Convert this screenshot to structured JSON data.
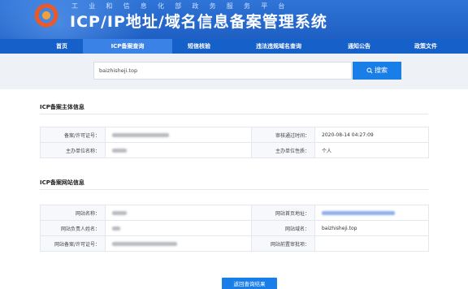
{
  "header": {
    "subtitle": "工业和信息化部政务服务平台",
    "title": "ICP/IP地址/域名信息备案管理系统"
  },
  "nav": {
    "items": [
      {
        "label": "首页",
        "active": false
      },
      {
        "label": "ICP备案查询",
        "active": true
      },
      {
        "label": "短信核验",
        "active": false
      },
      {
        "label": "违法违规域名查询",
        "active": false
      },
      {
        "label": "通知公告",
        "active": false
      },
      {
        "label": "政策文件",
        "active": false
      }
    ]
  },
  "search": {
    "value": "baizhisheji.top",
    "button_label": "搜索"
  },
  "subject_section": {
    "title": "ICP备案主体信息",
    "labels": {
      "license_no": "备案/许可证号：",
      "review_time": "审核通过时间：",
      "org_name": "主办单位名称：",
      "org_type": "主办单位性质："
    },
    "values": {
      "review_time": "2020-08-14 04:27:09",
      "org_type": "个人"
    }
  },
  "website_section": {
    "title": "ICP备案网站信息",
    "labels": {
      "site_name": "网站名称：",
      "home_url": "网站首页地址：",
      "principal": "网站负责人姓名：",
      "domain": "网站域名：",
      "site_license": "网站备案/许可证号：",
      "pre_approval": "网站前置审批项："
    },
    "values": {
      "domain": "baizhisheji.top"
    }
  },
  "back_button": {
    "label": "返回查询结果"
  },
  "colors": {
    "header_blue": "#2f74d6",
    "nav_blue": "#1560c9",
    "accent_blue": "#1a7ee8"
  }
}
